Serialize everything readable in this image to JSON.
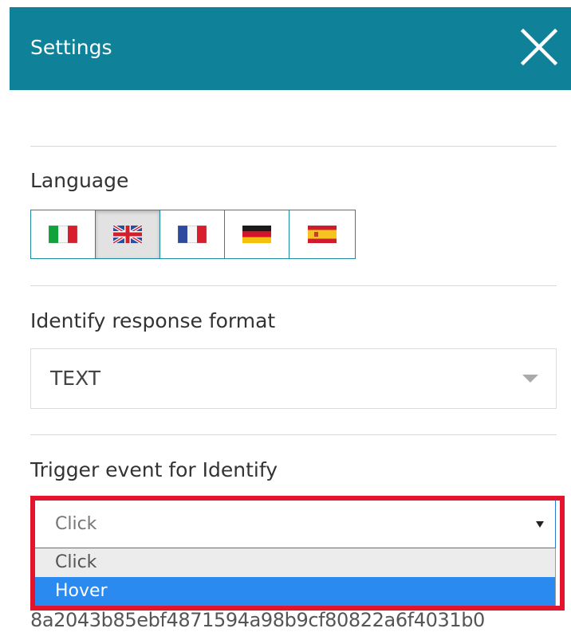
{
  "header": {
    "title": "Settings",
    "close_icon": "close-icon",
    "background_color": "#0f8198"
  },
  "language": {
    "label": "Language",
    "options": [
      {
        "code": "it",
        "icon": "italy-flag-icon",
        "active": false
      },
      {
        "code": "en",
        "icon": "uk-flag-icon",
        "active": true
      },
      {
        "code": "fr",
        "icon": "france-flag-icon",
        "active": false
      },
      {
        "code": "de",
        "icon": "germany-flag-icon",
        "active": false
      },
      {
        "code": "es",
        "icon": "spain-flag-icon",
        "active": false
      }
    ]
  },
  "response_format": {
    "label": "Identify response format",
    "value": "TEXT",
    "caret_icon": "caret-down-icon"
  },
  "trigger_event": {
    "label": "Trigger event for Identify",
    "value": "Click",
    "options": [
      "Click",
      "Hover"
    ],
    "selected_option": "Click",
    "hovered_option": "Hover",
    "highlight_color": "#e4142c"
  },
  "footer": {
    "hash": "8a2043b85ebf4871594a98b9cf80822a6f4031b0"
  },
  "colors": {
    "accent": "#1c8aa2",
    "option_hover": "#2a8af0"
  }
}
